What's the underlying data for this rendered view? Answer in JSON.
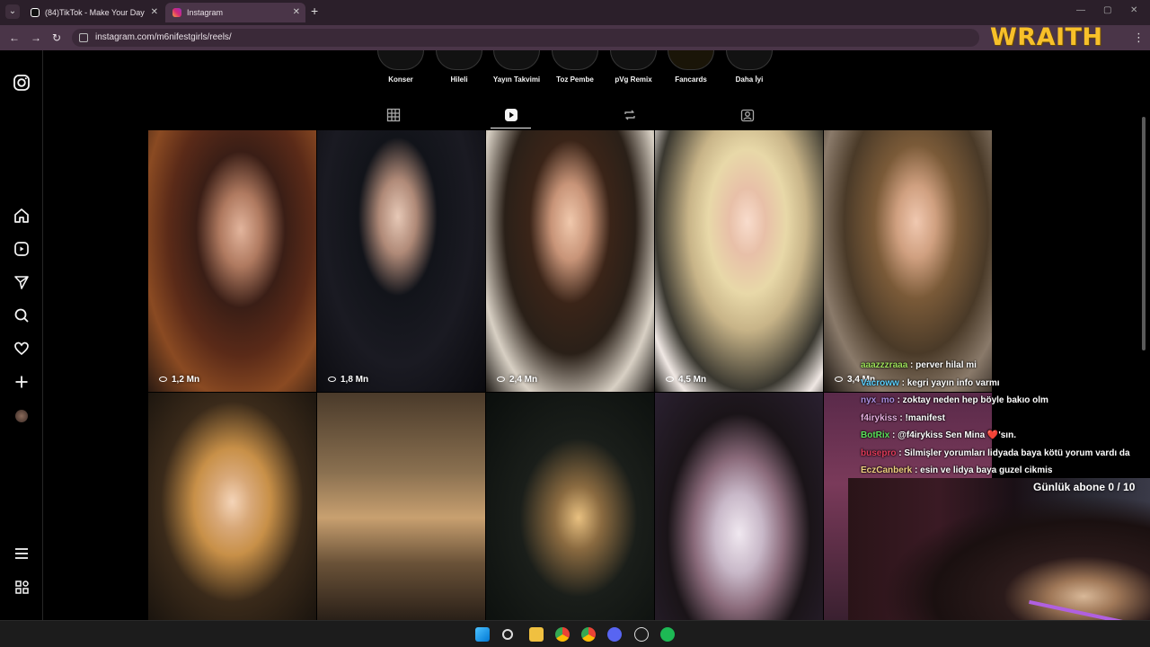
{
  "browser": {
    "tabs": [
      {
        "title": "(84)TikTok - Make Your Day",
        "close": "✕"
      },
      {
        "title": "Instagram",
        "close": "✕"
      }
    ],
    "new_tab": "+",
    "url": "instagram.com/m6nifestgirls/reels/",
    "overlay_logo": "WRAITH"
  },
  "icons": {
    "instagram": "instagram-icon",
    "home": "home-icon",
    "reels": "reels-icon",
    "messages": "send-icon",
    "search": "search-icon",
    "notifications": "heart-icon",
    "create": "plus-icon",
    "menu": "menu-icon",
    "more": "more-apps-icon"
  },
  "highlights": [
    "Konser",
    "Hileli",
    "Yayın Takvimi",
    "Toz Pembe",
    "pVg Remix",
    "Fancards",
    "Daha İyi"
  ],
  "profile_tabs": [
    "grid",
    "reels",
    "tagged-reposts",
    "tagged"
  ],
  "active_tab": "reels",
  "reels": [
    {
      "views": "1,2 Mn"
    },
    {
      "views": "1,8 Mn"
    },
    {
      "views": "2,4 Mn"
    },
    {
      "views": "4,5 Mn"
    },
    {
      "views": "3,4 Mn"
    }
  ],
  "chat": [
    {
      "user": "aaazzzraaa",
      "msg": " : perver hilal mi",
      "color": "#9ee05a"
    },
    {
      "user": "Vacroww",
      "msg": " : kegri yayın info varmı",
      "color": "#5ad0ff"
    },
    {
      "user": "nyx_mo",
      "msg": " : zoktay neden hep böyle bakıo olm",
      "color": "#a98de0"
    },
    {
      "user": "f4irykiss",
      "msg": " : !manifest",
      "color": "#e6b0e0"
    },
    {
      "user": "BotRix",
      "msg": " : @f4irykiss Sen Mina ❤️'sın.",
      "color": "#5ae05a"
    },
    {
      "user": "busepro",
      "msg": " : Silmişler yorumları lidyada baya kötü yorum vardı da",
      "color": "#e03a5a"
    },
    {
      "user": "EczCanberk",
      "msg": " : esin ve lidya baya guzel cikmis",
      "color": "#f0d080"
    }
  ],
  "sub_goal": "Günlük abone 0 / 10"
}
